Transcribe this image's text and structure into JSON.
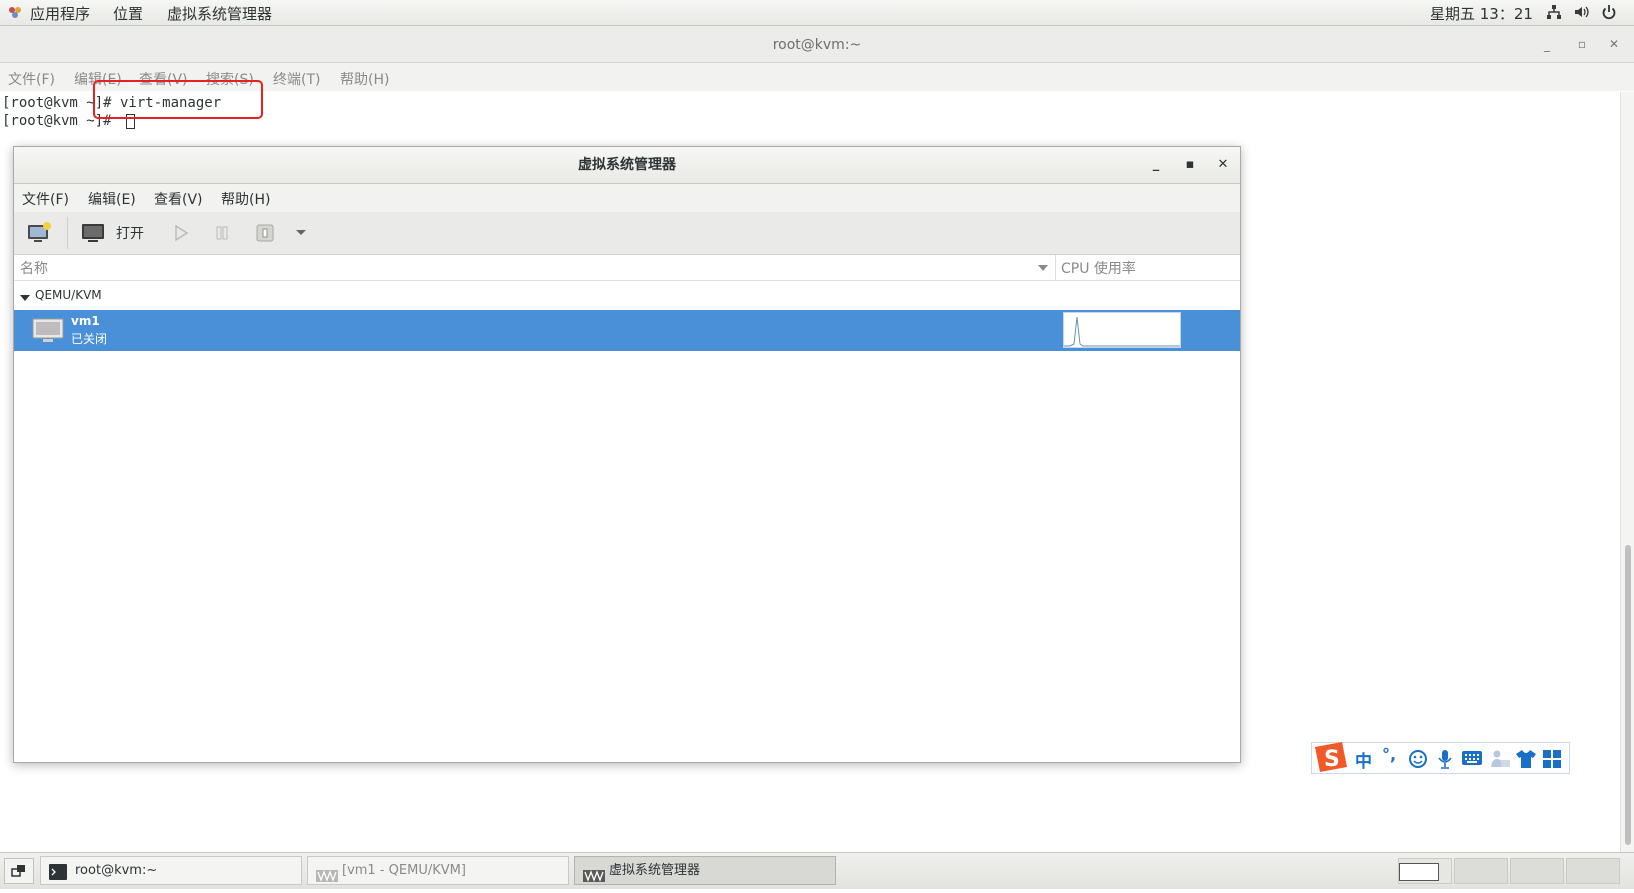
{
  "top_panel": {
    "applications": "应用程序",
    "places": "位置",
    "active_app": "虚拟系统管理器",
    "clock": "星期五 13：21"
  },
  "terminal": {
    "title": "root@kvm:~",
    "menu": [
      "文件(F)",
      "编辑(E)",
      "查看(V)",
      "搜索(S)",
      "终端(T)",
      "帮助(H)"
    ],
    "lines": [
      "[root@kvm ~]# virt-manager",
      "[root@kvm ~]# "
    ]
  },
  "virt_manager": {
    "title": "虚拟系统管理器",
    "menu": [
      "文件(F)",
      "编辑(E)",
      "查看(V)",
      "帮助(H)"
    ],
    "toolbar_open_label": "打开",
    "columns": {
      "name": "名称",
      "cpu": "CPU 使用率"
    },
    "connection": "QEMU/KVM",
    "vm": {
      "name": "vm1",
      "status": "已关闭"
    }
  },
  "ime": {
    "mode": "中",
    "punct": "°,"
  },
  "taskbar": {
    "tasks": [
      "root@kvm:~",
      "[vm1 - QEMU/KVM]",
      "虚拟系统管理器"
    ]
  },
  "colors": {
    "selection": "#4a90d9",
    "highlight_box": "#e8201f",
    "ime_brand": "#f05a28",
    "ime_blue": "#1a6fc7"
  }
}
